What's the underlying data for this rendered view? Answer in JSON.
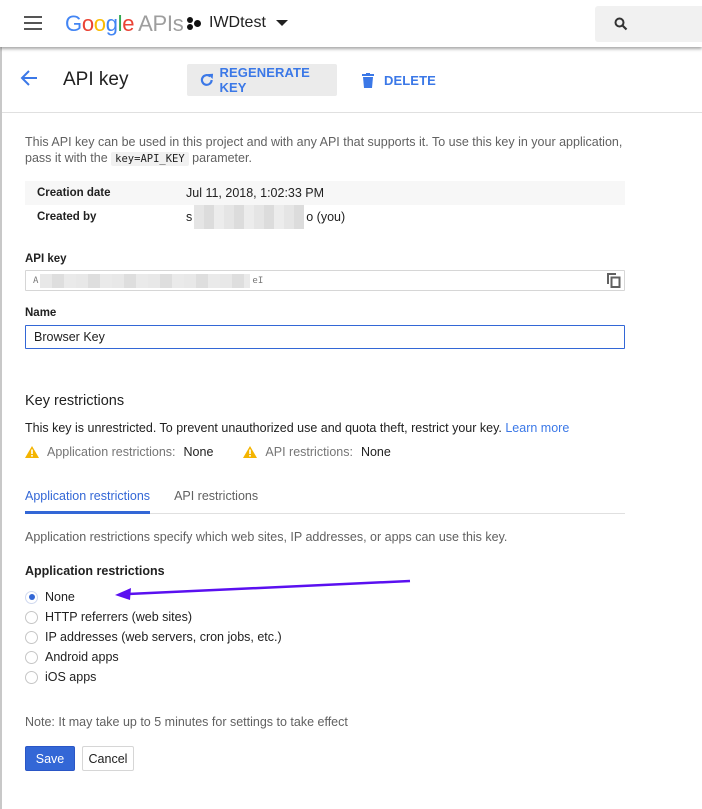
{
  "topbar": {
    "logo_google": [
      "G",
      "o",
      "o",
      "g",
      "l",
      "e"
    ],
    "logo_apis": "APIs",
    "project_name": "IWDtest"
  },
  "header": {
    "title": "API key",
    "regenerate_label": "REGENERATE KEY",
    "delete_label": "DELETE"
  },
  "description": {
    "text_before": "This API key can be used in this project and with any API that supports it. To use this key in your application, pass it with the ",
    "code": "key=API_KEY",
    "text_after": " parameter."
  },
  "metadata": {
    "creation_date_label": "Creation date",
    "creation_date_value": "Jul 11, 2018, 1:02:33 PM",
    "created_by_label": "Created by",
    "created_by_prefix": "s",
    "created_by_suffix": "o (you)"
  },
  "api_key": {
    "label": "API key",
    "value_prefix": "A",
    "value_suffix": "eI"
  },
  "name": {
    "label": "Name",
    "value": "Browser Key"
  },
  "key_restrictions": {
    "title": "Key restrictions",
    "unrestricted_text": "This key is unrestricted. To prevent unauthorized use and quota theft, restrict your key. ",
    "learn_more": "Learn more",
    "app_restrictions_label": "Application restrictions:",
    "app_restrictions_value": "None",
    "api_restrictions_label": "API restrictions:",
    "api_restrictions_value": "None",
    "warning_color": "#f4b400"
  },
  "tabs": [
    {
      "label": "Application restrictions",
      "active": true
    },
    {
      "label": "API restrictions",
      "active": false
    }
  ],
  "application_restrictions": {
    "description": "Application restrictions specify which web sites, IP addresses, or apps can use this key.",
    "title": "Application restrictions",
    "options": [
      {
        "label": "None",
        "selected": true
      },
      {
        "label": "HTTP referrers (web sites)",
        "selected": false
      },
      {
        "label": "IP addresses (web servers, cron jobs, etc.)",
        "selected": false
      },
      {
        "label": "Android apps",
        "selected": false
      },
      {
        "label": "iOS apps",
        "selected": false
      }
    ]
  },
  "annotation": {
    "arrow_color": "#5a10f0"
  },
  "footer": {
    "note": "Note: It may take up to 5 minutes for settings to take effect",
    "save_label": "Save",
    "cancel_label": "Cancel"
  },
  "colors": {
    "accent": "#3367d6",
    "link": "#3b78e7"
  }
}
